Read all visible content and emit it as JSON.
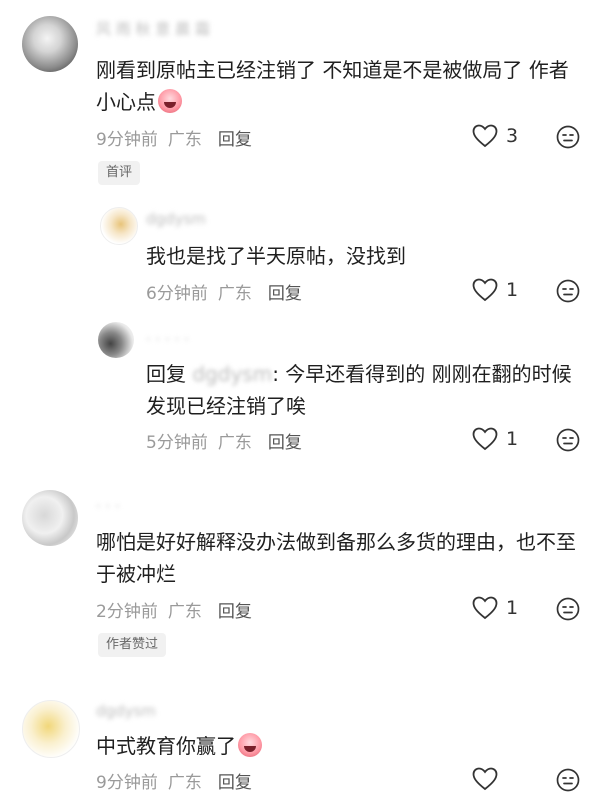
{
  "comments": [
    {
      "text": "刚看到原帖主已经注销了 不知道是不是被做局了 作者小心点",
      "time": "9分钟前",
      "region": "广东",
      "reply_label": "回复",
      "likes": "3",
      "badge": "首评"
    },
    {
      "text": "我也是找了半天原帖，没找到",
      "time": "6分钟前",
      "region": "广东",
      "reply_label": "回复",
      "likes": "1"
    },
    {
      "reply_prefix": "回复",
      "text": "今早还看得到的 刚刚在翻的时候发现已经注销了唉",
      "time": "5分钟前",
      "region": "广东",
      "reply_label": "回复",
      "likes": "1"
    },
    {
      "text": "哪怕是好好解释没办法做到备那么多货的理由，也不至于被冲烂",
      "time": "2分钟前",
      "region": "广东",
      "reply_label": "回复",
      "likes": "1",
      "badge": "作者赞过"
    },
    {
      "text": "中式教育你赢了",
      "time": "9分钟前",
      "region": "广东",
      "reply_label": "回复",
      "likes": ""
    }
  ]
}
